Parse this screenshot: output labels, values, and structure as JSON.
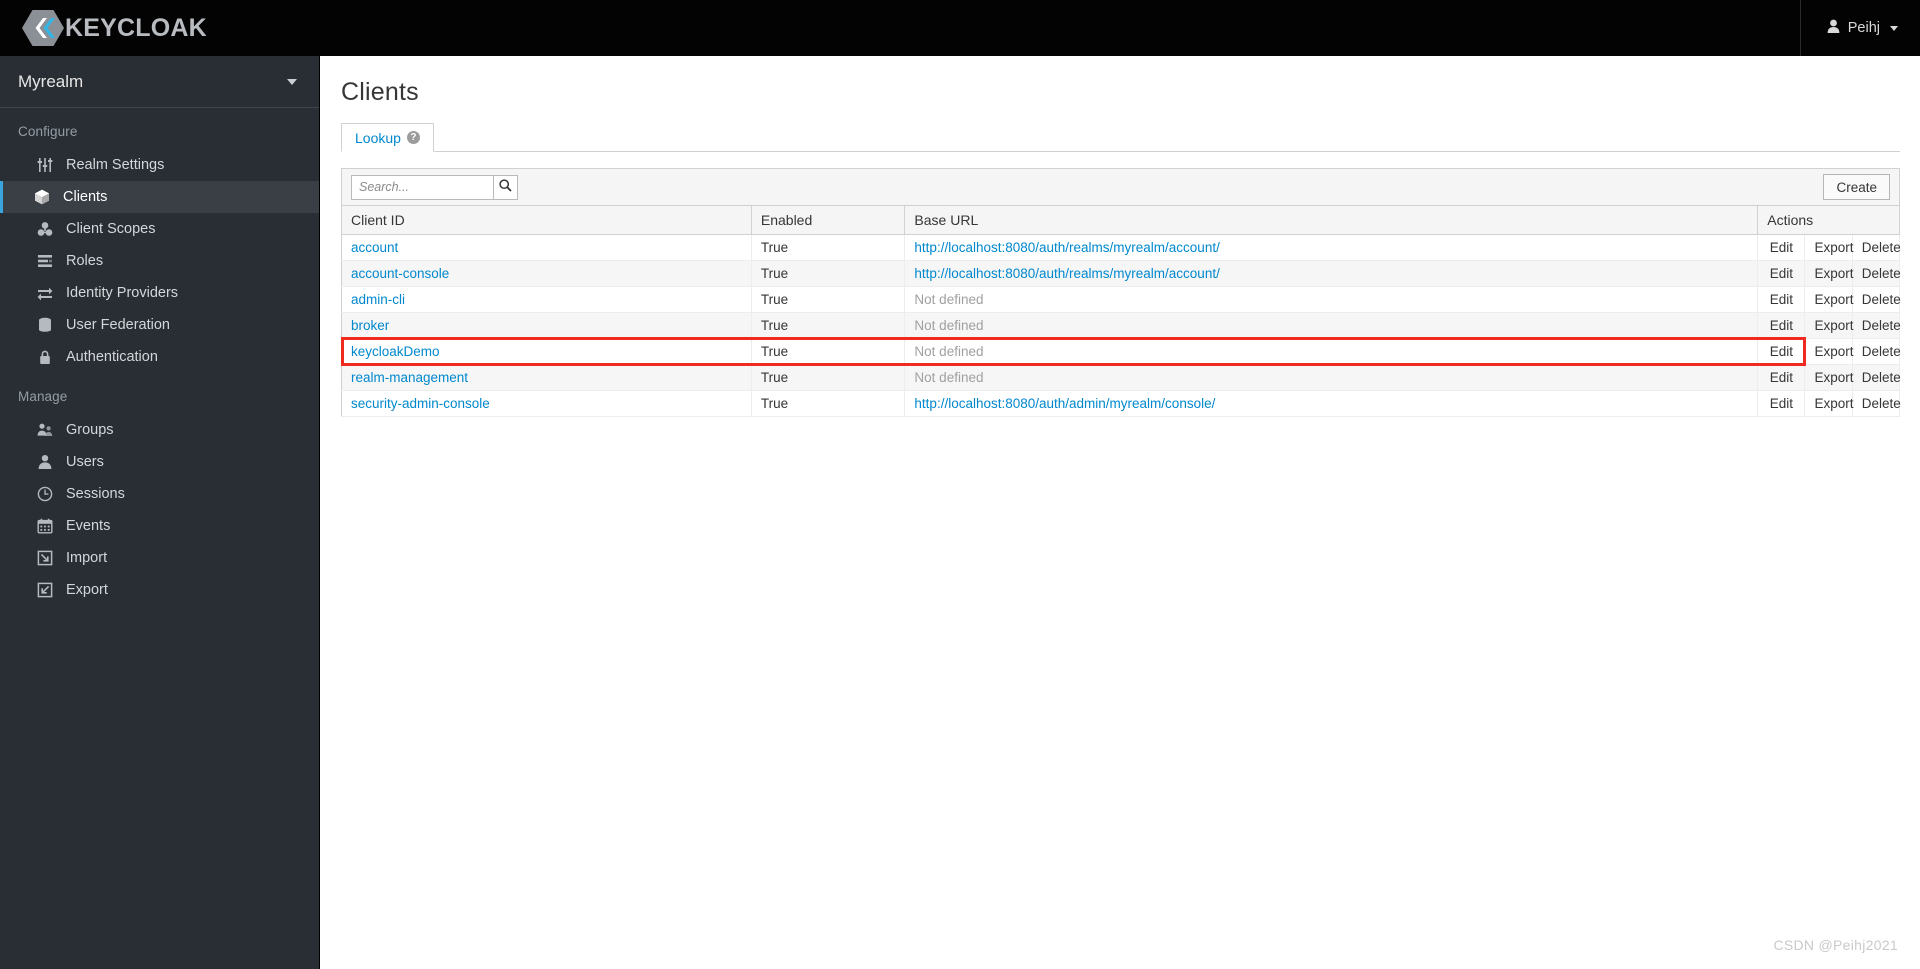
{
  "masthead": {
    "brand_name": "KEYCLOAK",
    "brand_logo_icon": "keycloak-hexagon-logo",
    "user_name": "Peihj",
    "user_icon": "user-avatar-icon",
    "user_caret_icon": "chevron-down-icon"
  },
  "sidebar": {
    "realm_name": "Myrealm",
    "realm_caret_icon": "chevron-down-icon",
    "sections": [
      {
        "label": "Configure",
        "items": [
          {
            "label": "Realm Settings",
            "icon": "sliders-icon",
            "active": false
          },
          {
            "label": "Clients",
            "icon": "cube-icon",
            "active": true
          },
          {
            "label": "Client Scopes",
            "icon": "cubes-icon",
            "active": false
          },
          {
            "label": "Roles",
            "icon": "list-rows-icon",
            "active": false
          },
          {
            "label": "Identity Providers",
            "icon": "exchange-arrows-icon",
            "active": false
          },
          {
            "label": "User Federation",
            "icon": "database-icon",
            "active": false
          },
          {
            "label": "Authentication",
            "icon": "lock-icon",
            "active": false
          }
        ]
      },
      {
        "label": "Manage",
        "items": [
          {
            "label": "Groups",
            "icon": "group-users-icon",
            "active": false
          },
          {
            "label": "Users",
            "icon": "user-icon",
            "active": false
          },
          {
            "label": "Sessions",
            "icon": "clock-icon",
            "active": false
          },
          {
            "label": "Events",
            "icon": "calendar-icon",
            "active": false
          },
          {
            "label": "Import",
            "icon": "arrow-import-icon",
            "active": false
          },
          {
            "label": "Export",
            "icon": "arrow-export-icon",
            "active": false
          }
        ]
      }
    ]
  },
  "main": {
    "page_title": "Clients",
    "tabs": [
      {
        "label": "Lookup",
        "help_glyph": "?",
        "active": true
      }
    ],
    "toolbar": {
      "search_placeholder": "Search...",
      "search_value": "",
      "search_icon": "search-icon",
      "create_label": "Create"
    },
    "table": {
      "headers": [
        "Client ID",
        "Enabled",
        "Base URL",
        "Actions"
      ],
      "actions": [
        "Edit",
        "Export",
        "Delete"
      ],
      "not_defined_text": "Not defined",
      "rows": [
        {
          "client_id": "account",
          "enabled": "True",
          "base_url": "http://localhost:8080/auth/realms/myrealm/account/",
          "url_defined": true,
          "highlighted": false
        },
        {
          "client_id": "account-console",
          "enabled": "True",
          "base_url": "http://localhost:8080/auth/realms/myrealm/account/",
          "url_defined": true,
          "highlighted": false
        },
        {
          "client_id": "admin-cli",
          "enabled": "True",
          "base_url": "Not defined",
          "url_defined": false,
          "highlighted": false
        },
        {
          "client_id": "broker",
          "enabled": "True",
          "base_url": "Not defined",
          "url_defined": false,
          "highlighted": false
        },
        {
          "client_id": "keycloakDemo",
          "enabled": "True",
          "base_url": "Not defined",
          "url_defined": false,
          "highlighted": true
        },
        {
          "client_id": "realm-management",
          "enabled": "True",
          "base_url": "Not defined",
          "url_defined": false,
          "highlighted": false
        },
        {
          "client_id": "security-admin-console",
          "enabled": "True",
          "base_url": "http://localhost:8080/auth/admin/myrealm/console/",
          "url_defined": true,
          "highlighted": false
        }
      ]
    }
  },
  "annotation": {
    "highlight_color": "#ef2a1f"
  },
  "watermark": {
    "text": "CSDN @Peihj2021"
  }
}
